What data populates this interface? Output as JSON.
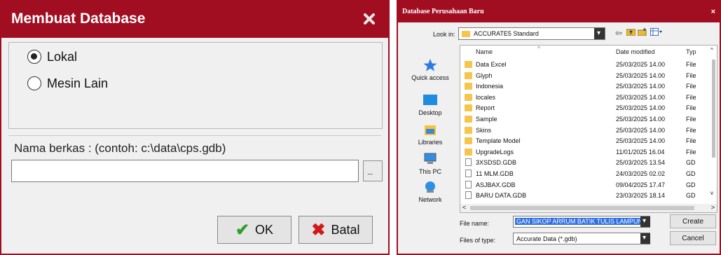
{
  "dialog1": {
    "title": "Membuat Database",
    "radio_local": "Lokal",
    "radio_other": "Mesin Lain",
    "file_label": "Nama berkas :  (contoh: c:\\data\\cps.gdb)",
    "file_value": "",
    "ok_label": "OK",
    "cancel_label": "Batal"
  },
  "dialog2": {
    "title": "Database Perusahaan Baru",
    "close": "×",
    "look_in_label": "Look in:",
    "look_in_value": "ACCURATE5 Standard",
    "places": [
      "Quick access",
      "Desktop",
      "Libraries",
      "This PC",
      "Network"
    ],
    "columns": {
      "name": "Name",
      "date": "Date modified",
      "type": "Typ"
    },
    "files": [
      {
        "name": "Data Excel",
        "date": "25/03/2025 14.00",
        "type": "File",
        "kind": "folder"
      },
      {
        "name": "Glyph",
        "date": "25/03/2025 14.00",
        "type": "File",
        "kind": "folder"
      },
      {
        "name": "Indonesia",
        "date": "25/03/2025 14.00",
        "type": "File",
        "kind": "folder"
      },
      {
        "name": "locales",
        "date": "25/03/2025 14.00",
        "type": "File",
        "kind": "folder"
      },
      {
        "name": "Report",
        "date": "25/03/2025 14.00",
        "type": "File",
        "kind": "folder"
      },
      {
        "name": "Sample",
        "date": "25/03/2025 14.00",
        "type": "File",
        "kind": "folder"
      },
      {
        "name": "Skins",
        "date": "25/03/2025 14.00",
        "type": "File",
        "kind": "folder"
      },
      {
        "name": "Template Model",
        "date": "25/03/2025 14.00",
        "type": "File",
        "kind": "folder"
      },
      {
        "name": "UpgradeLogs",
        "date": "11/01/2025 16.04",
        "type": "File",
        "kind": "folder"
      },
      {
        "name": "3XSDSD.GDB",
        "date": "25/03/2025 13.54",
        "type": "GD",
        "kind": "file"
      },
      {
        "name": "11 MLM.GDB",
        "date": "24/03/2025 02.02",
        "type": "GD",
        "kind": "file"
      },
      {
        "name": "ASJBAX.GDB",
        "date": "09/04/2025 17.47",
        "type": "GD",
        "kind": "file"
      },
      {
        "name": "BARU DATA.GDB",
        "date": "23/03/2025 18.14",
        "type": "GD",
        "kind": "file"
      }
    ],
    "file_name_label": "File name:",
    "file_name_value": "GAN SIKOP ARRUM BATIK TULIS LAMPUNG",
    "file_type_label": "Files of type:",
    "file_type_value": "Accurate Data (*.gdb)",
    "create_label": "Create",
    "cancel_label": "Cancel"
  },
  "colors": {
    "titlebar": "#a10d21",
    "selection": "#2f6fe0",
    "folder": "#f6c54a"
  }
}
